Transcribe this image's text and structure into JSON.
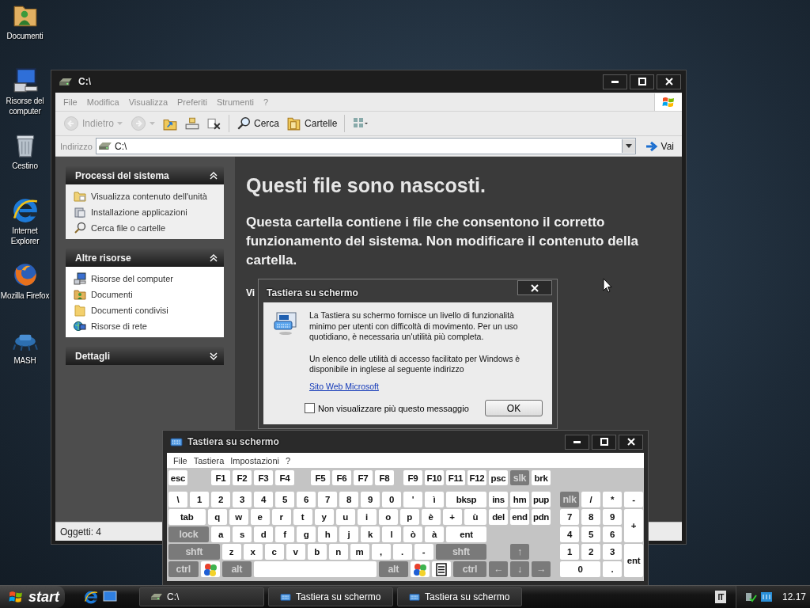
{
  "desktop_icons": [
    {
      "label": "Documenti",
      "kind": "documents"
    },
    {
      "label": "Risorse del computer",
      "kind": "computer"
    },
    {
      "label": "Cestino",
      "kind": "bin"
    },
    {
      "label": "Internet Explorer",
      "kind": "ie"
    },
    {
      "label": "Mozilla Firefox",
      "kind": "firefox"
    },
    {
      "label": "MASH",
      "kind": "mash"
    }
  ],
  "explorer": {
    "title": "C:\\",
    "menu": [
      "File",
      "Modifica",
      "Visualizza",
      "Preferiti",
      "Strumenti",
      "?"
    ],
    "toolbar": [
      {
        "kind": "back",
        "label": "Indietro",
        "disabled": true
      },
      {
        "kind": "forward",
        "disabled": true
      },
      {
        "kind": "up",
        "disabled": false
      },
      {
        "kind": "move",
        "disabled": false
      },
      {
        "kind": "delete",
        "disabled": false
      },
      {
        "kind": "search",
        "label": "Cerca",
        "disabled": false
      },
      {
        "kind": "folders",
        "label": "Cartelle",
        "disabled": false
      },
      {
        "kind": "views",
        "disabled": false
      }
    ],
    "address": {
      "label": "Indirizzo",
      "value": "C:\\",
      "go": "Vai"
    },
    "panels": [
      {
        "title": "Processi del sistema",
        "expanded": true,
        "items": [
          {
            "label": "Visualizza contenuto dell'unità",
            "kind": "view"
          },
          {
            "label": "Installazione applicazioni",
            "kind": "install"
          },
          {
            "label": "Cerca file o cartelle",
            "kind": "search"
          }
        ]
      },
      {
        "title": "Altre risorse",
        "expanded": true,
        "items": [
          {
            "label": "Risorse del computer",
            "kind": "computer"
          },
          {
            "label": "Documenti",
            "kind": "documents"
          },
          {
            "label": "Documenti condivisi",
            "kind": "folder"
          },
          {
            "label": "Risorse di rete",
            "kind": "network"
          }
        ]
      },
      {
        "title": "Dettagli",
        "expanded": false
      }
    ],
    "content": {
      "heading": "Questi file sono nascosti.",
      "text": "Questa cartella contiene i file che consentono il corretto funzionamento del sistema. Non modificare il contenuto della cartella.",
      "link": "Vi"
    },
    "status": "Oggetti: 4"
  },
  "dialog": {
    "title": "Tastiera su schermo",
    "message": "La Tastiera su schermo fornisce un livello di funzionalità minimo per utenti con difficoltà di movimento. Per un uso quotidiano, è necessaria un'utilità più completa.",
    "message_2": "Un elenco delle utilità di accesso facilitato per Windows è disponibile in inglese al seguente indirizzo",
    "link": "Sito Web Microsoft",
    "checkbox": {
      "label": "Non visualizzare più questo messaggio",
      "checked": false
    },
    "ok": "OK"
  },
  "keyboard": {
    "title": "Tastiera su schermo",
    "menu": [
      "File",
      "Tastiera",
      "Impostazioni",
      "?"
    ],
    "rows": [
      {
        "keys": [
          {
            "label": "esc",
            "kind": "key",
            "disabled": false
          },
          {
            "label": "F1",
            "kind": "key",
            "disabled": false
          },
          {
            "label": "F2",
            "kind": "key",
            "disabled": false
          },
          {
            "label": "F3",
            "kind": "key",
            "disabled": false
          },
          {
            "label": "F4",
            "kind": "key",
            "disabled": false
          },
          {
            "label": "F5",
            "kind": "key",
            "disabled": false
          },
          {
            "label": "F6",
            "kind": "key",
            "disabled": false
          },
          {
            "label": "F7",
            "kind": "key",
            "disabled": false
          },
          {
            "label": "F8",
            "kind": "key",
            "disabled": false
          },
          {
            "label": "F9",
            "kind": "key",
            "disabled": false
          },
          {
            "label": "F10",
            "kind": "key",
            "disabled": false
          },
          {
            "label": "F11",
            "kind": "key",
            "disabled": false
          },
          {
            "label": "F12",
            "kind": "key",
            "disabled": false
          },
          {
            "label": "psc",
            "kind": "key",
            "disabled": false
          },
          {
            "label": "slk",
            "kind": "key",
            "disabled": true
          },
          {
            "label": "brk",
            "kind": "key",
            "disabled": false
          }
        ]
      },
      {
        "keys": [
          {
            "label": "\\",
            "kind": "key",
            "disabled": false
          },
          {
            "label": "1",
            "kind": "key",
            "disabled": false
          },
          {
            "label": "2",
            "kind": "key",
            "disabled": false
          },
          {
            "label": "3",
            "kind": "key",
            "disabled": false
          },
          {
            "label": "4",
            "kind": "key",
            "disabled": false
          },
          {
            "label": "5",
            "kind": "key",
            "disabled": false
          },
          {
            "label": "6",
            "kind": "key",
            "disabled": false
          },
          {
            "label": "7",
            "kind": "key",
            "disabled": false
          },
          {
            "label": "8",
            "kind": "key",
            "disabled": false
          },
          {
            "label": "9",
            "kind": "key",
            "disabled": false
          },
          {
            "label": "0",
            "kind": "key",
            "disabled": false
          },
          {
            "label": "'",
            "kind": "key",
            "disabled": false
          },
          {
            "label": "ì",
            "kind": "key",
            "disabled": false
          },
          {
            "label": "bksp",
            "kind": "key",
            "disabled": false
          },
          {
            "label": "ins",
            "kind": "key",
            "disabled": false
          },
          {
            "label": "hm",
            "kind": "key",
            "disabled": false
          },
          {
            "label": "pup",
            "kind": "key",
            "disabled": false
          },
          {
            "label": "nlk",
            "kind": "key",
            "disabled": true
          },
          {
            "label": "/",
            "kind": "key",
            "disabled": false
          },
          {
            "label": "*",
            "kind": "key",
            "disabled": false
          },
          {
            "label": "-",
            "kind": "key",
            "disabled": false
          }
        ]
      },
      {
        "keys": [
          {
            "label": "tab",
            "kind": "key",
            "disabled": false
          },
          {
            "label": "q",
            "kind": "key",
            "disabled": false
          },
          {
            "label": "w",
            "kind": "key",
            "disabled": false
          },
          {
            "label": "e",
            "kind": "key",
            "disabled": false
          },
          {
            "label": "r",
            "kind": "key",
            "disabled": false
          },
          {
            "label": "t",
            "kind": "key",
            "disabled": false
          },
          {
            "label": "y",
            "kind": "key",
            "disabled": false
          },
          {
            "label": "u",
            "kind": "key",
            "disabled": false
          },
          {
            "label": "i",
            "kind": "key",
            "disabled": false
          },
          {
            "label": "o",
            "kind": "key",
            "disabled": false
          },
          {
            "label": "p",
            "kind": "key",
            "disabled": false
          },
          {
            "label": "è",
            "kind": "key",
            "disabled": false
          },
          {
            "label": "+",
            "kind": "key",
            "disabled": false
          },
          {
            "label": "ù",
            "kind": "key",
            "disabled": false
          },
          {
            "label": "del",
            "kind": "key",
            "disabled": false
          },
          {
            "label": "end",
            "kind": "key",
            "disabled": false
          },
          {
            "label": "pdn",
            "kind": "key",
            "disabled": false
          },
          {
            "label": "7",
            "kind": "key",
            "disabled": false
          },
          {
            "label": "8",
            "kind": "key",
            "disabled": false
          },
          {
            "label": "9",
            "kind": "key",
            "disabled": false
          },
          {
            "label": "+",
            "kind": "key",
            "disabled": false
          }
        ]
      },
      {
        "keys": [
          {
            "label": "lock",
            "kind": "key",
            "disabled": true
          },
          {
            "label": "a",
            "kind": "key",
            "disabled": false
          },
          {
            "label": "s",
            "kind": "key",
            "disabled": false
          },
          {
            "label": "d",
            "kind": "key",
            "disabled": false
          },
          {
            "label": "f",
            "kind": "key",
            "disabled": false
          },
          {
            "label": "g",
            "kind": "key",
            "disabled": false
          },
          {
            "label": "h",
            "kind": "key",
            "disabled": false
          },
          {
            "label": "j",
            "kind": "key",
            "disabled": false
          },
          {
            "label": "k",
            "kind": "key",
            "disabled": false
          },
          {
            "label": "l",
            "kind": "key",
            "disabled": false
          },
          {
            "label": "ò",
            "kind": "key",
            "disabled": false
          },
          {
            "label": "à",
            "kind": "key",
            "disabled": false
          },
          {
            "label": "ent",
            "kind": "key",
            "disabled": false
          },
          {
            "label": "4",
            "kind": "key",
            "disabled": false
          },
          {
            "label": "5",
            "kind": "key",
            "disabled": false
          },
          {
            "label": "6",
            "kind": "key",
            "disabled": false
          }
        ]
      },
      {
        "keys": [
          {
            "label": "shft",
            "kind": "key",
            "disabled": true
          },
          {
            "label": "z",
            "kind": "key",
            "disabled": false
          },
          {
            "label": "x",
            "kind": "key",
            "disabled": false
          },
          {
            "label": "c",
            "kind": "key",
            "disabled": false
          },
          {
            "label": "v",
            "kind": "key",
            "disabled": false
          },
          {
            "label": "b",
            "kind": "key",
            "disabled": false
          },
          {
            "label": "n",
            "kind": "key",
            "disabled": false
          },
          {
            "label": "m",
            "kind": "key",
            "disabled": false
          },
          {
            "label": ",",
            "kind": "key",
            "disabled": false
          },
          {
            "label": ".",
            "kind": "key",
            "disabled": false
          },
          {
            "label": "-",
            "kind": "key",
            "disabled": false
          },
          {
            "label": "shft",
            "kind": "key",
            "disabled": true
          },
          {
            "label": "↑",
            "kind": "key",
            "disabled": true
          },
          {
            "label": "1",
            "kind": "key",
            "disabled": false
          },
          {
            "label": "2",
            "kind": "key",
            "disabled": false
          },
          {
            "label": "3",
            "kind": "key",
            "disabled": false
          },
          {
            "label": "ent",
            "kind": "key",
            "disabled": false
          }
        ]
      },
      {
        "keys": [
          {
            "label": "ctrl",
            "kind": "key",
            "disabled": true
          },
          {
            "kind": "win",
            "disabled": false
          },
          {
            "label": "alt",
            "kind": "key",
            "disabled": true
          },
          {
            "kind": "space",
            "disabled": false
          },
          {
            "label": "alt",
            "kind": "key",
            "disabled": true
          },
          {
            "kind": "win",
            "disabled": false
          },
          {
            "kind": "menu",
            "disabled": false
          },
          {
            "label": "ctrl",
            "kind": "key",
            "disabled": true
          },
          {
            "label": "←",
            "kind": "key",
            "disabled": true
          },
          {
            "label": "↓",
            "kind": "key",
            "disabled": true
          },
          {
            "label": "→",
            "kind": "key",
            "disabled": true
          },
          {
            "label": "0",
            "kind": "key",
            "disabled": false
          },
          {
            "label": ".",
            "kind": "key",
            "disabled": false
          }
        ]
      }
    ]
  },
  "taskbar": {
    "start": "start",
    "quick_launch": [
      {
        "kind": "ie"
      },
      {
        "kind": "desktop"
      }
    ],
    "tasks": [
      {
        "label": "C:\\",
        "kind": "drive",
        "selected": false
      },
      {
        "label": "Tastiera su schermo",
        "kind": "keyboard",
        "selected": false
      },
      {
        "label": "Tastiera su schermo",
        "kind": "keyboard",
        "selected": false
      }
    ],
    "language": "IT",
    "clock": "12.17"
  }
}
